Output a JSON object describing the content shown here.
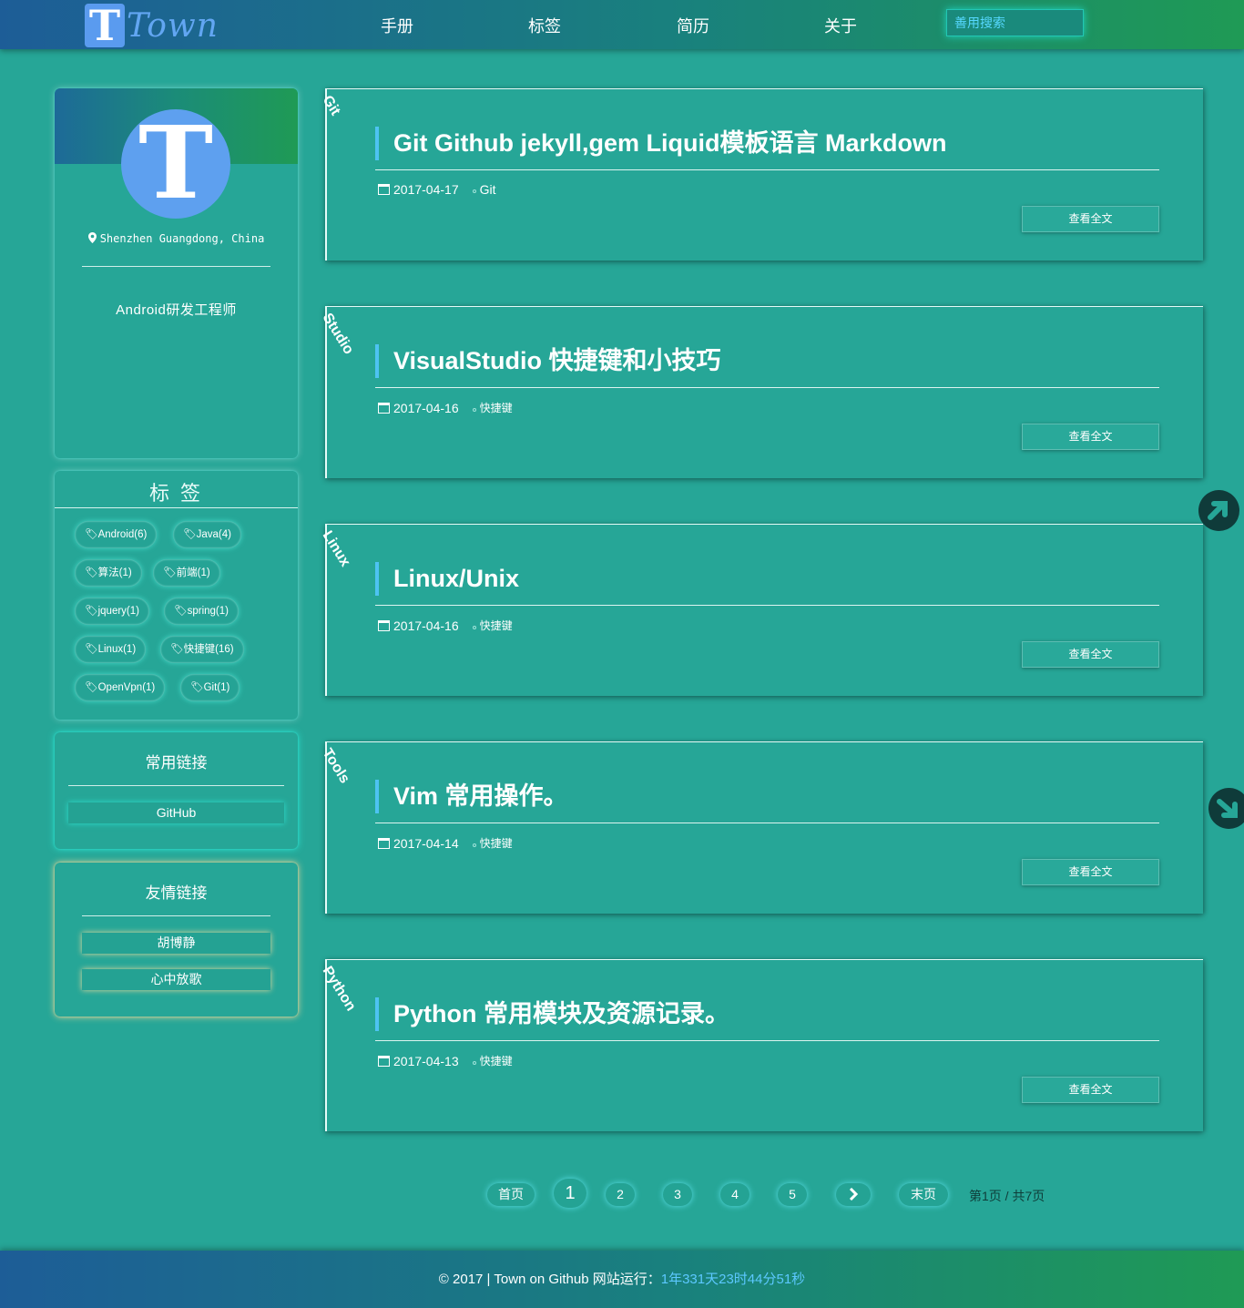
{
  "header": {
    "logo_letter": "T",
    "logo_text": "Town",
    "nav": [
      "手册",
      "标签",
      "简历",
      "关于"
    ],
    "search_placeholder": "善用搜索"
  },
  "profile": {
    "avatar_letter": "T",
    "location": "Shenzhen Guangdong, China",
    "job": "Android研发工程师"
  },
  "tags": {
    "title": "标 签",
    "items": [
      "Android(6)",
      "Java(4)",
      "算法(1)",
      "前端(1)",
      "jquery(1)",
      "spring(1)",
      "Linux(1)",
      "快捷键(16)",
      "OpenVpn(1)",
      "Git(1)"
    ]
  },
  "links": {
    "title": "常用链接",
    "items": [
      "GitHub"
    ]
  },
  "friends": {
    "title": "友情链接",
    "items": [
      "胡博静",
      "心中放歌"
    ]
  },
  "posts": [
    {
      "category": "Git",
      "title": "Git Github jekyll,gem Liquid模板语言 Markdown",
      "date": "2017-04-17",
      "tag": "Git"
    },
    {
      "category": "Studio",
      "title": "VisualStudio 快捷键和小技巧",
      "date": "2017-04-16",
      "tag": "快捷键"
    },
    {
      "category": "Linux",
      "title": "Linux/Unix",
      "date": "2017-04-16",
      "tag": "快捷键"
    },
    {
      "category": "Tools",
      "title": "Vim 常用操作。",
      "date": "2017-04-14",
      "tag": "快捷键"
    },
    {
      "category": "Python",
      "title": "Python 常用模块及资源记录。",
      "date": "2017-04-13",
      "tag": "快捷键"
    }
  ],
  "read_more_label": "查看全文",
  "pagination": {
    "first": "首页",
    "pages": [
      "1",
      "2",
      "3",
      "4",
      "5"
    ],
    "current_page": 1,
    "last": "末页",
    "info": "第1页 / 共7页"
  },
  "footer": {
    "text": "© 2017 | Town on Github 网站运行：",
    "runtime": "1年331天23时44分51秒"
  },
  "colors": {
    "background": "#26a697",
    "accent_blue": "#4dc3f2",
    "logo_blue": "#5ea0ef"
  }
}
